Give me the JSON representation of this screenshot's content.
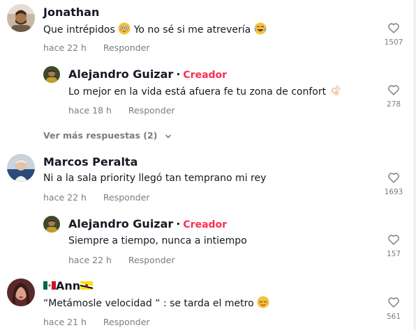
{
  "comments": [
    {
      "user": "Jonathan",
      "text_before": "Que intrépidos ",
      "text_after": " Yo no sé si me atrevería ",
      "time": "hace 22 h",
      "reply": "Responder",
      "likes": "1507",
      "emoji1": "flushed-face",
      "emoji2": "tears-of-joy-face"
    },
    {
      "user": "Alejandro Guizar",
      "separator": "·",
      "badge": "Creador",
      "text_before": "Lo mejor en la vida está afuera fe tu zona de confort ",
      "time": "hace 18 h",
      "reply": "Responder",
      "likes": "278",
      "emoji1": "ok-hand"
    },
    {
      "user": "Marcos Peralta",
      "text": "Ni a la sala priority llegó tan temprano mi rey",
      "time": "hace 22 h",
      "reply": "Responder",
      "likes": "1693"
    },
    {
      "user": "Alejandro Guizar",
      "separator": "·",
      "badge": "Creador",
      "text": "Siempre a tiempo, nunca a intiempo",
      "time": "hace 22 h",
      "reply": "Responder",
      "likes": "157"
    },
    {
      "user": "Ann",
      "text_before": "“Metámosle velocidad “ : se tarda el metro ",
      "time": "hace 21 h",
      "reply": "Responder",
      "likes": "561",
      "emoji1": "relieved-face",
      "flag_left": "mexico-flag",
      "flag_right": "brunei-flag"
    }
  ],
  "view_more": "Ver más respuestas (2)",
  "colors": {
    "creator": "#fe2c55",
    "muted": "#7b7c82",
    "text": "#161823"
  }
}
